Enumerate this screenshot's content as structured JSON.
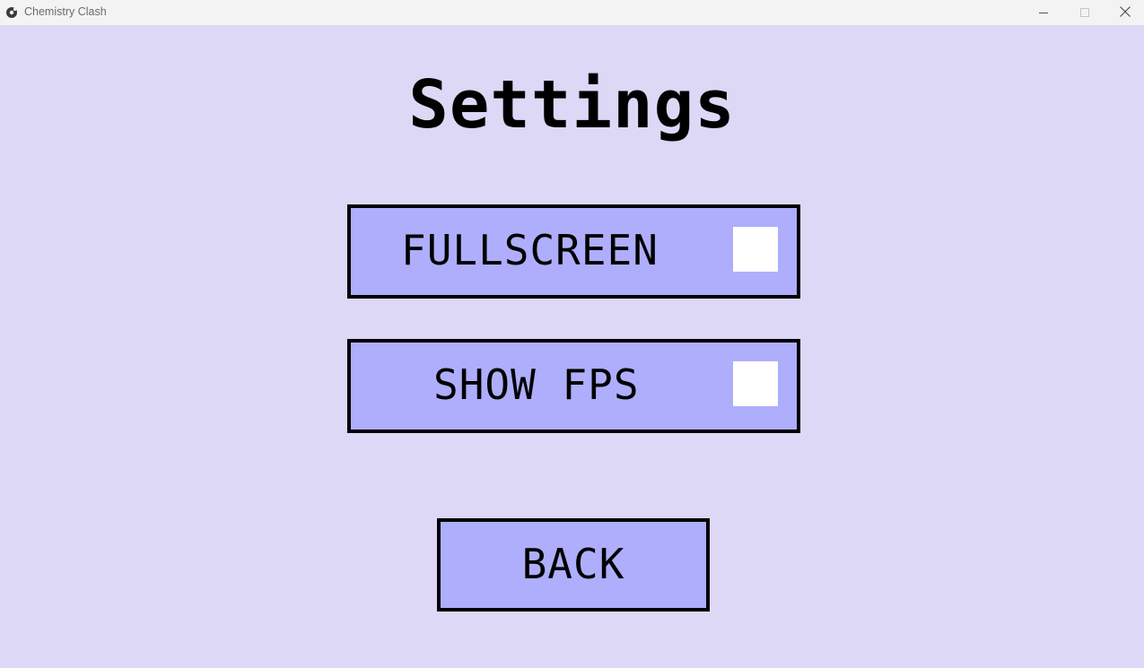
{
  "window": {
    "title": "Chemistry Clash",
    "controls": [
      "minimize-icon",
      "maximize-icon",
      "close-icon"
    ]
  },
  "screen": {
    "heading": "Settings"
  },
  "settings": [
    {
      "label": "FULLSCREEN",
      "checked": false
    },
    {
      "label": "SHOW FPS",
      "checked": false
    }
  ],
  "back_label": "BACK",
  "colors": {
    "background": "#dcd8f6",
    "button_fill": "#aeaefc",
    "button_border": "#000000",
    "checkbox": "#ffffff",
    "titlebar": "#f3f3f3"
  }
}
